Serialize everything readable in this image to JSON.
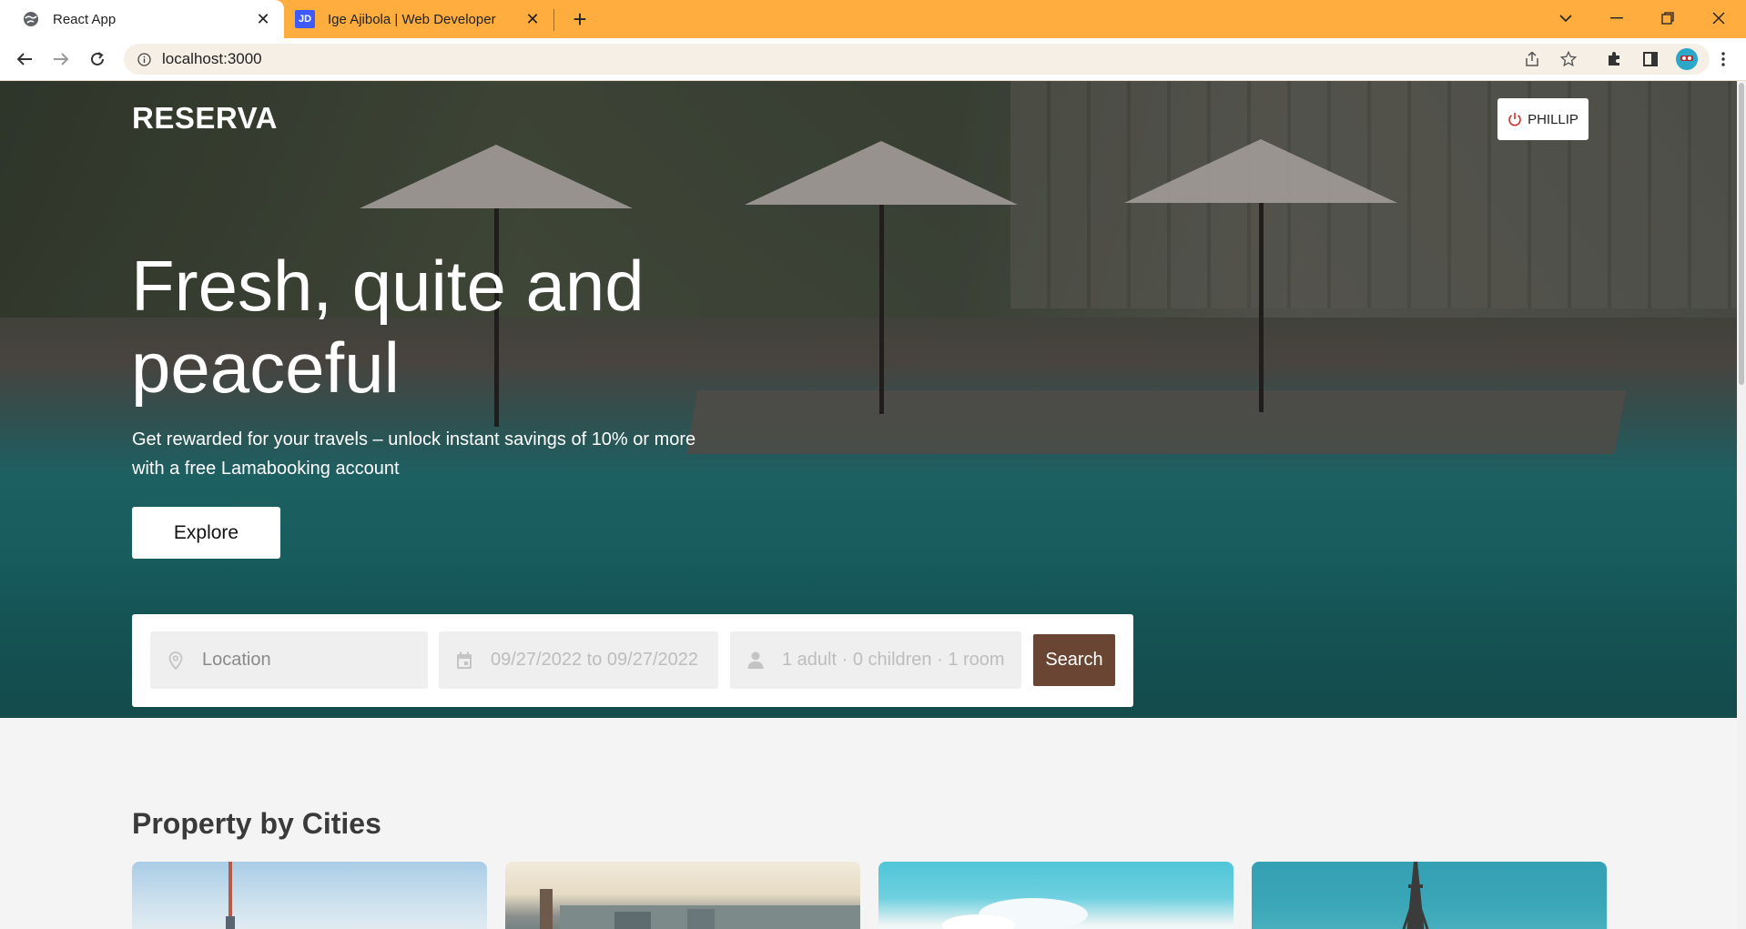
{
  "browser": {
    "tabs": [
      {
        "title": "React App",
        "icon": "globe-icon",
        "active": true
      },
      {
        "title": "Ige Ajibola | Web Developer",
        "icon": "jd-favicon",
        "active": false
      }
    ],
    "favicon_text": "JD",
    "url": "localhost:3000",
    "accent_color": "#ffad3f"
  },
  "header": {
    "logo": "RESERVA",
    "user_button": "PHILLIP"
  },
  "hero": {
    "title": "Fresh, quite and peaceful",
    "subtitle": "Get rewarded for your travels – unlock instant savings of 10% or more with a free Lamabooking account",
    "explore_button": "Explore"
  },
  "search": {
    "location_placeholder": "Location",
    "dates_value": "09/27/2022 to 09/27/2022",
    "occupancy_value": "1 adult · 0 children · 1 room",
    "search_button": "Search",
    "button_color": "#6b4533"
  },
  "sections": {
    "property_by_cities": "Property by Cities"
  }
}
